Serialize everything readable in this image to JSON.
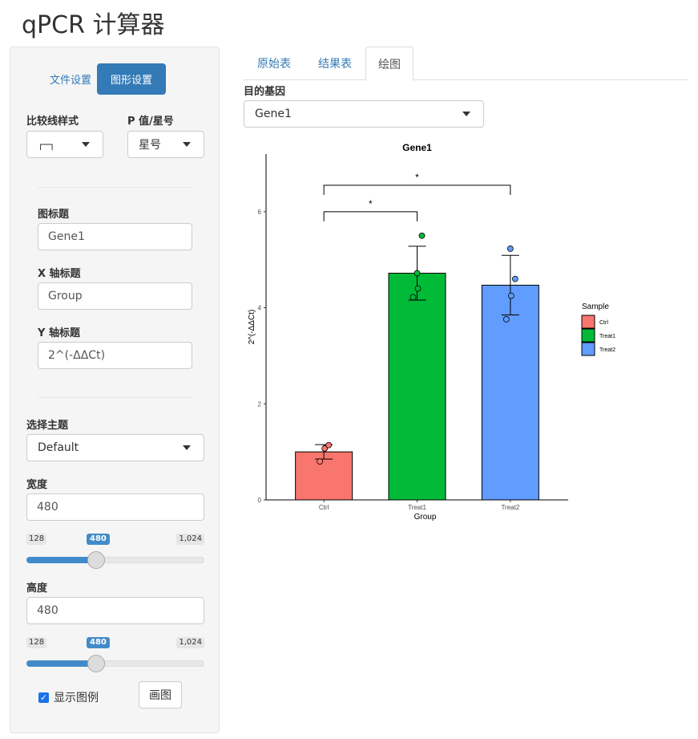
{
  "app": {
    "title": "qPCR 计算器"
  },
  "sidebar": {
    "tabs": [
      "文件设置",
      "图形设置"
    ],
    "compare_line": {
      "label": "比较线样式",
      "value": "┌─┐"
    },
    "pvalue": {
      "label": "P 值/星号",
      "value": "星号"
    },
    "chart_title": {
      "label": "图标题",
      "value": "Gene1"
    },
    "x_title": {
      "label": "X 轴标题",
      "value": "Group"
    },
    "y_title": {
      "label": "Y 轴标题",
      "value": "2^(-ΔΔCt)"
    },
    "theme": {
      "label": "选择主题",
      "value": "Default"
    },
    "width": {
      "label": "宽度",
      "value": "480",
      "min": "128",
      "max": "1,024",
      "current": "480",
      "fraction": 0.394
    },
    "height": {
      "label": "高度",
      "value": "480",
      "min": "128",
      "max": "1,024",
      "current": "480",
      "fraction": 0.394
    },
    "show_legend": {
      "label": "显示图例",
      "checked": true
    },
    "draw_button": "画图"
  },
  "main": {
    "tabs": [
      "原始表",
      "结果表",
      "绘图"
    ],
    "gene_select": {
      "label": "目的基因",
      "value": "Gene1"
    }
  },
  "chart_data": {
    "type": "bar",
    "title": "Gene1",
    "xlabel": "Group",
    "ylabel": "2^(-ΔΔCt)",
    "categories": [
      "Ctrl",
      "Treat1",
      "Treat2"
    ],
    "values": [
      1.0,
      4.72,
      4.47
    ],
    "errors": [
      0.15,
      0.56,
      0.62
    ],
    "points": [
      [
        0.8,
        1.07,
        1.14
      ],
      [
        4.22,
        4.4,
        5.5,
        4.72
      ],
      [
        3.76,
        4.25,
        4.6,
        5.23
      ]
    ],
    "colors": [
      "#f8766d",
      "#00ba38",
      "#619cff"
    ],
    "ylim": [
      0,
      7.2
    ],
    "yticks": [
      0,
      2,
      4,
      6
    ],
    "legend": {
      "title": "Sample",
      "entries": [
        "Ctrl",
        "Treat1",
        "Treat2"
      ],
      "position": "right"
    },
    "comparisons": [
      {
        "from": "Ctrl",
        "to": "Treat1",
        "label": "*",
        "y": 6.0
      },
      {
        "from": "Ctrl",
        "to": "Treat2",
        "label": "*",
        "y": 6.55
      }
    ]
  }
}
